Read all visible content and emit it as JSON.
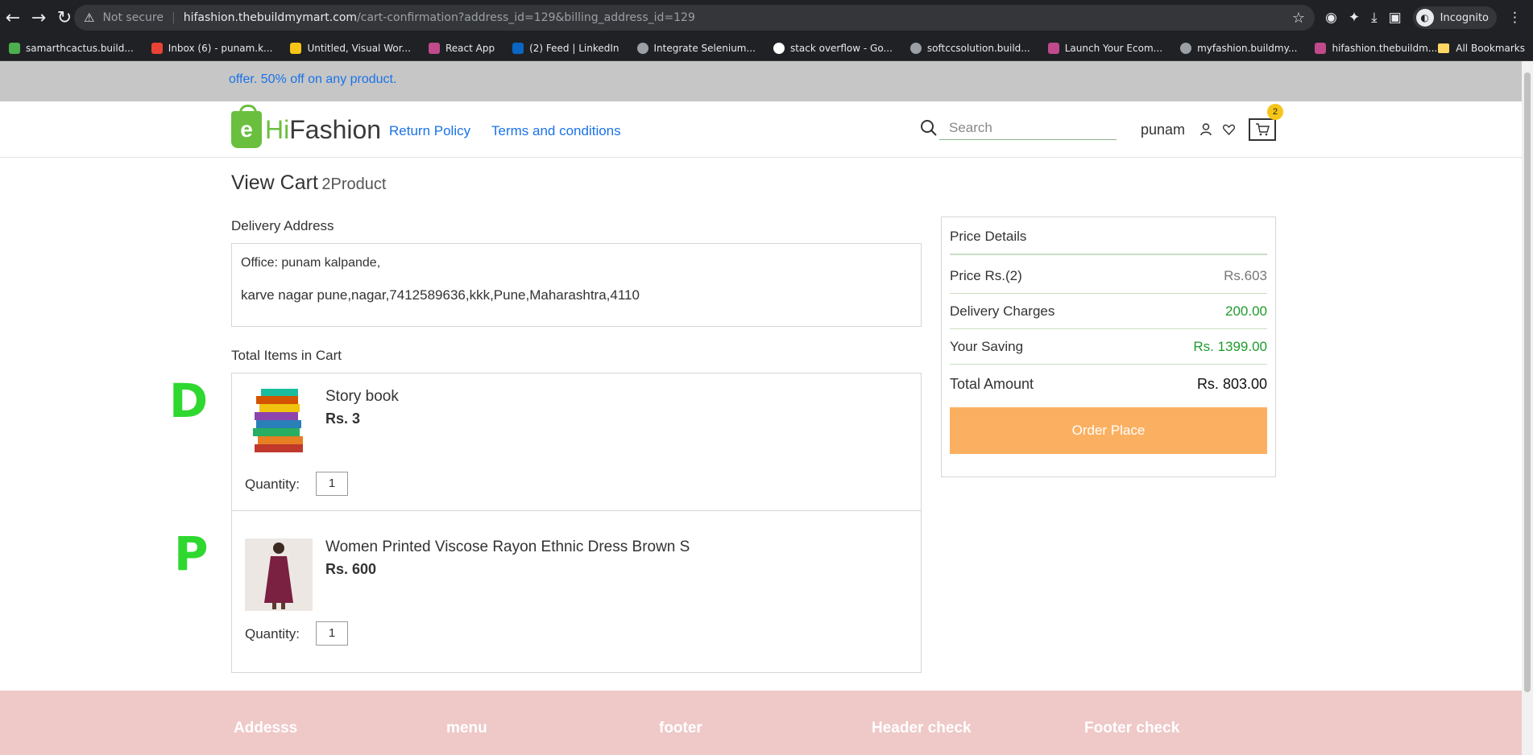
{
  "browser": {
    "security_label": "Not secure",
    "url_host": "hifashion.thebuildmymart.com",
    "url_path": "/cart-confirmation?address_id=129&billing_address_id=129",
    "profile_label": "Incognito",
    "bookmarks": [
      {
        "label": "samarthcactus.build...",
        "color": "#4caf50"
      },
      {
        "label": "Inbox (6) - punam.k...",
        "color": "#ea4335"
      },
      {
        "label": "Untitled, Visual Wor...",
        "color": "#f5c518"
      },
      {
        "label": "React App",
        "color": "#c04a8c"
      },
      {
        "label": "(2) Feed | LinkedIn",
        "color": "#0a66c2"
      },
      {
        "label": "Integrate Selenium...",
        "color": "#9aa0a6"
      },
      {
        "label": "stack overflow - Go...",
        "color": "#ffffff"
      },
      {
        "label": "softccsolution.build...",
        "color": "#9aa0a6"
      },
      {
        "label": "Launch Your Ecom...",
        "color": "#c04a8c"
      },
      {
        "label": "myfashion.buildmy...",
        "color": "#9aa0a6"
      },
      {
        "label": "hifashion.thebuildm...",
        "color": "#c04a8c"
      }
    ],
    "all_bookmarks_label": "All Bookmarks"
  },
  "offer": {
    "text": "offer. 50% off on any product."
  },
  "header": {
    "logo_e": "e",
    "logo_hi": "Hi",
    "logo_fashion": "Fashion",
    "nav": [
      "Return Policy",
      "Terms and conditions"
    ],
    "search_placeholder": "Search",
    "username": "punam",
    "cart_count": "2"
  },
  "cart": {
    "title": "View Cart",
    "count_label": "2Product",
    "delivery_label": "Delivery Address",
    "address_line1": "Office: punam kalpande,",
    "address_line2": "karve nagar pune,nagar,7412589636,kkk,Pune,Maharashtra,4110",
    "items_label": "Total Items in Cart",
    "quantity_label": "Quantity:",
    "items": [
      {
        "name": "Story book",
        "price": "Rs. 3",
        "qty": "1"
      },
      {
        "name": "Women Printed Viscose Rayon Ethnic Dress Brown S",
        "price": "Rs. 600",
        "qty": "1"
      }
    ],
    "marks": [
      "D",
      "P"
    ]
  },
  "price_details": {
    "title": "Price Details",
    "rows": [
      {
        "label": "Price Rs.(2)",
        "value": "Rs.603",
        "color": "#777777"
      },
      {
        "label": "Delivery Charges",
        "value": "200.00",
        "color": "#1e9b2e"
      },
      {
        "label": "Your Saving",
        "value": "Rs. 1399.00",
        "color": "#1e9b2e"
      },
      {
        "label": "Total Amount",
        "value": "Rs. 803.00",
        "color": "#111111"
      }
    ],
    "order_button": "Order Place"
  },
  "footer": {
    "columns": [
      "Addesss",
      "menu",
      "footer",
      "Header check",
      "Footer check"
    ]
  }
}
